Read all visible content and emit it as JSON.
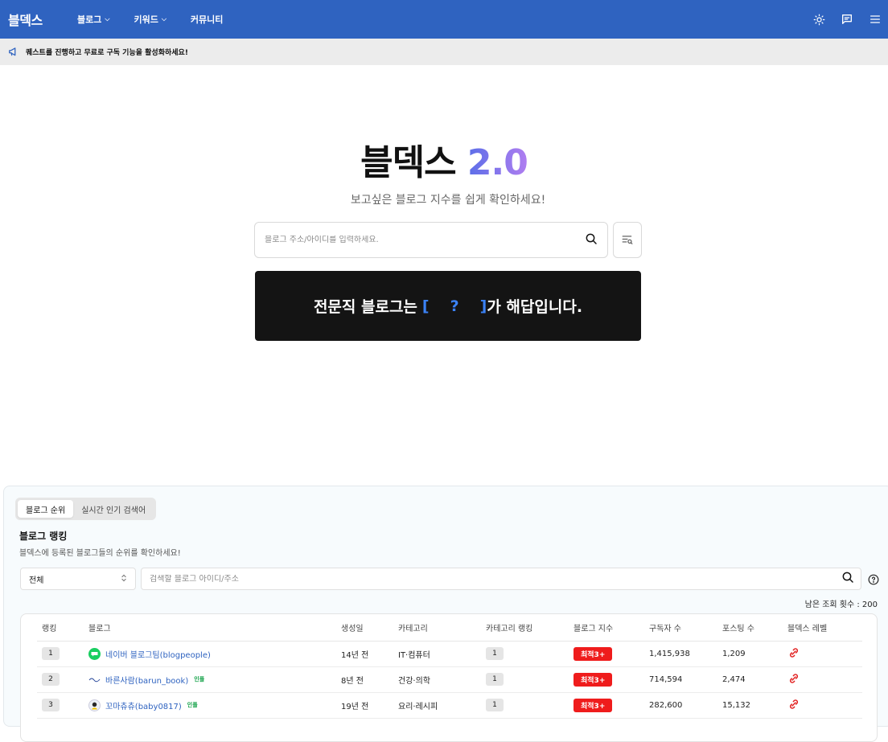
{
  "header": {
    "logo": "블덱스",
    "nav": [
      {
        "label": "블로그",
        "dropdown": true
      },
      {
        "label": "키워드",
        "dropdown": true
      },
      {
        "label": "커뮤니티",
        "dropdown": false
      }
    ],
    "icons": [
      "sun-icon",
      "chat-icon",
      "menu-icon"
    ],
    "bg_color": "#2f63c0"
  },
  "notice": {
    "icon": "megaphone-icon",
    "text": "퀘스트를 진행하고 무료로 구독 기능을 활성화하세요!"
  },
  "hero": {
    "title": "블덱스",
    "version": "2.0",
    "subtitle": "보고싶은 블로그 지수를 쉽게 확인하세요!",
    "search_placeholder": "블로그 주소/아이디를 입력하세요.",
    "banner": {
      "prefix": "전문직 블로그는 ",
      "bracket_open": "[",
      "question": "?",
      "bracket_close": "]",
      "suffix": "가 해답입니다."
    }
  },
  "ranking": {
    "tabs": [
      {
        "label": "블로그 순위",
        "active": true
      },
      {
        "label": "실시간 인기 검색어",
        "active": false
      }
    ],
    "title": "블로그 랭킹",
    "description": "블덱스에 등록된 블로그들의 순위를 확인하세요!",
    "filter_selected": "전체",
    "search_placeholder": "검색할 블로그 아이디/주소",
    "remaining_text": "남은 조회 횟수 : 200",
    "columns": [
      "랭킹",
      "블로그",
      "생성일",
      "카테고리",
      "카테고리 랭킹",
      "블로그 지수",
      "구독자 수",
      "포스팅 수",
      "블덱스 레벨"
    ],
    "rows": [
      {
        "rank": "1",
        "blog": "네이버 블로그팀(blogpeople)",
        "tag": "",
        "created": "14년 전",
        "category": "IT·컴퓨터",
        "cat_rank": "1",
        "index": "최적3+",
        "subscribers": "1,415,938",
        "posts": "1,209",
        "icon_color": "#19ce60"
      },
      {
        "rank": "2",
        "blog": "바른사람(barun_book)",
        "tag": "인플",
        "created": "8년 전",
        "category": "건강·의학",
        "cat_rank": "1",
        "index": "최적3+",
        "subscribers": "714,594",
        "posts": "2,474",
        "icon_color": "#2b4a9c"
      },
      {
        "rank": "3",
        "blog": "꼬마츄츄(baby0817)",
        "tag": "인플",
        "created": "19년 전",
        "category": "요리·레시피",
        "cat_rank": "1",
        "index": "최적3+",
        "subscribers": "282,600",
        "posts": "15,132",
        "icon_color": "#2a2a2a"
      }
    ]
  }
}
